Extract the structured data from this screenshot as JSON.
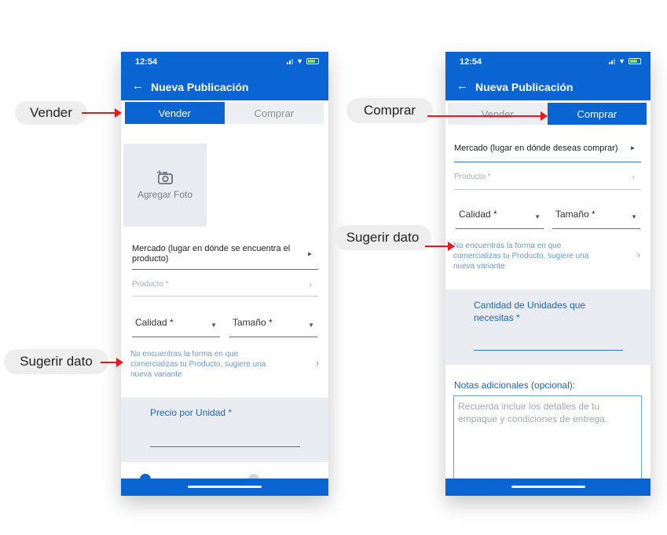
{
  "left_screen": {
    "status_time": "12:54",
    "header_title": "Nueva Publicación",
    "tabs": [
      {
        "label": "Vender",
        "active": true
      },
      {
        "label": "Comprar",
        "active": false
      }
    ],
    "photo_label": "Agregar Foto",
    "market_label": "Mercado (lugar en dónde se encuentra el producto)",
    "product_placeholder": "Producto *",
    "quality_label": "Calidad *",
    "size_label": "Tamaño *",
    "suggest_text": "No encuentras la forma en que comercializas tu Producto, sugiere una nueva variante",
    "price_label": "Precio por Unidad *"
  },
  "right_screen": {
    "status_time": "12:54",
    "header_title": "Nueva Publicación",
    "tabs": [
      {
        "label": "Vender",
        "active": false
      },
      {
        "label": "Comprar",
        "active": true
      }
    ],
    "market_label": "Mercado (lugar en dónde deseas comprar)",
    "product_placeholder": "Producto *",
    "quality_label": "Calidad *",
    "size_label": "Tamaño *",
    "suggest_text": "No encuentras la forma en que comercializas tu Producto, sugiere una nueva variante",
    "quantity_label": "Cantidad de Unidades que necesitas *",
    "notes_label": "Notas adicionales (opcional):",
    "notes_placeholder": "Recuerda incluir los detalles de tu empaque y condiciones de entrega."
  },
  "callouts": {
    "vender": "Vender",
    "sugerir_left": "Sugerir dato",
    "comprar": "Comprar",
    "sugerir_right": "Sugerir dato"
  },
  "colors": {
    "brand_blue": "#0a64d2",
    "arrow_red": "#e11d1d"
  },
  "icons": [
    "arrow-left-icon",
    "camera-add-icon",
    "chevron-right-icon",
    "chevron-down-icon",
    "signal-icon",
    "wifi-icon",
    "battery-icon"
  ]
}
